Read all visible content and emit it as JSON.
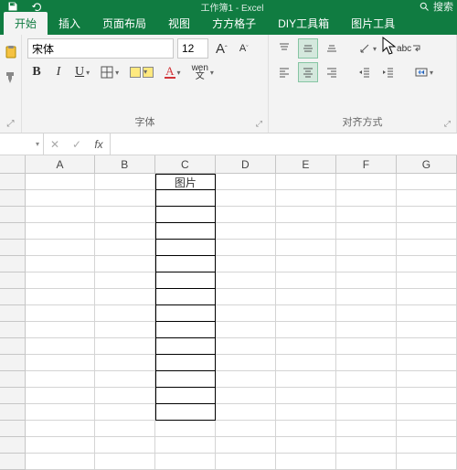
{
  "titlebar": {
    "doc": "工作簿1 - Excel",
    "search_placeholder": "搜索"
  },
  "tabs": {
    "t0": "开始",
    "t1": "插入",
    "t2": "页面布局",
    "t3": "视图",
    "t4": "方方格子",
    "t5": "DIY工具箱",
    "t6": "图片工具"
  },
  "font": {
    "name": "宋体",
    "size": "12",
    "grow": "A",
    "shrink": "A",
    "bold": "B",
    "italic": "I",
    "underline": "U",
    "wen": "wen",
    "wen2": "文",
    "A": "A",
    "group_label": "字体"
  },
  "align": {
    "abc": "abc",
    "group_label": "对齐方式"
  },
  "fx": {
    "fx_label": "fx"
  },
  "columns": {
    "A_w": 80,
    "B_w": 70,
    "C_w": 70,
    "D_w": 70,
    "E_w": 70,
    "F_w": 70,
    "G_w": 70
  },
  "col_labels": {
    "A": "A",
    "B": "B",
    "C": "C",
    "D": "D",
    "E": "E",
    "F": "F",
    "G": "G"
  },
  "cells": {
    "C1": "图片"
  }
}
